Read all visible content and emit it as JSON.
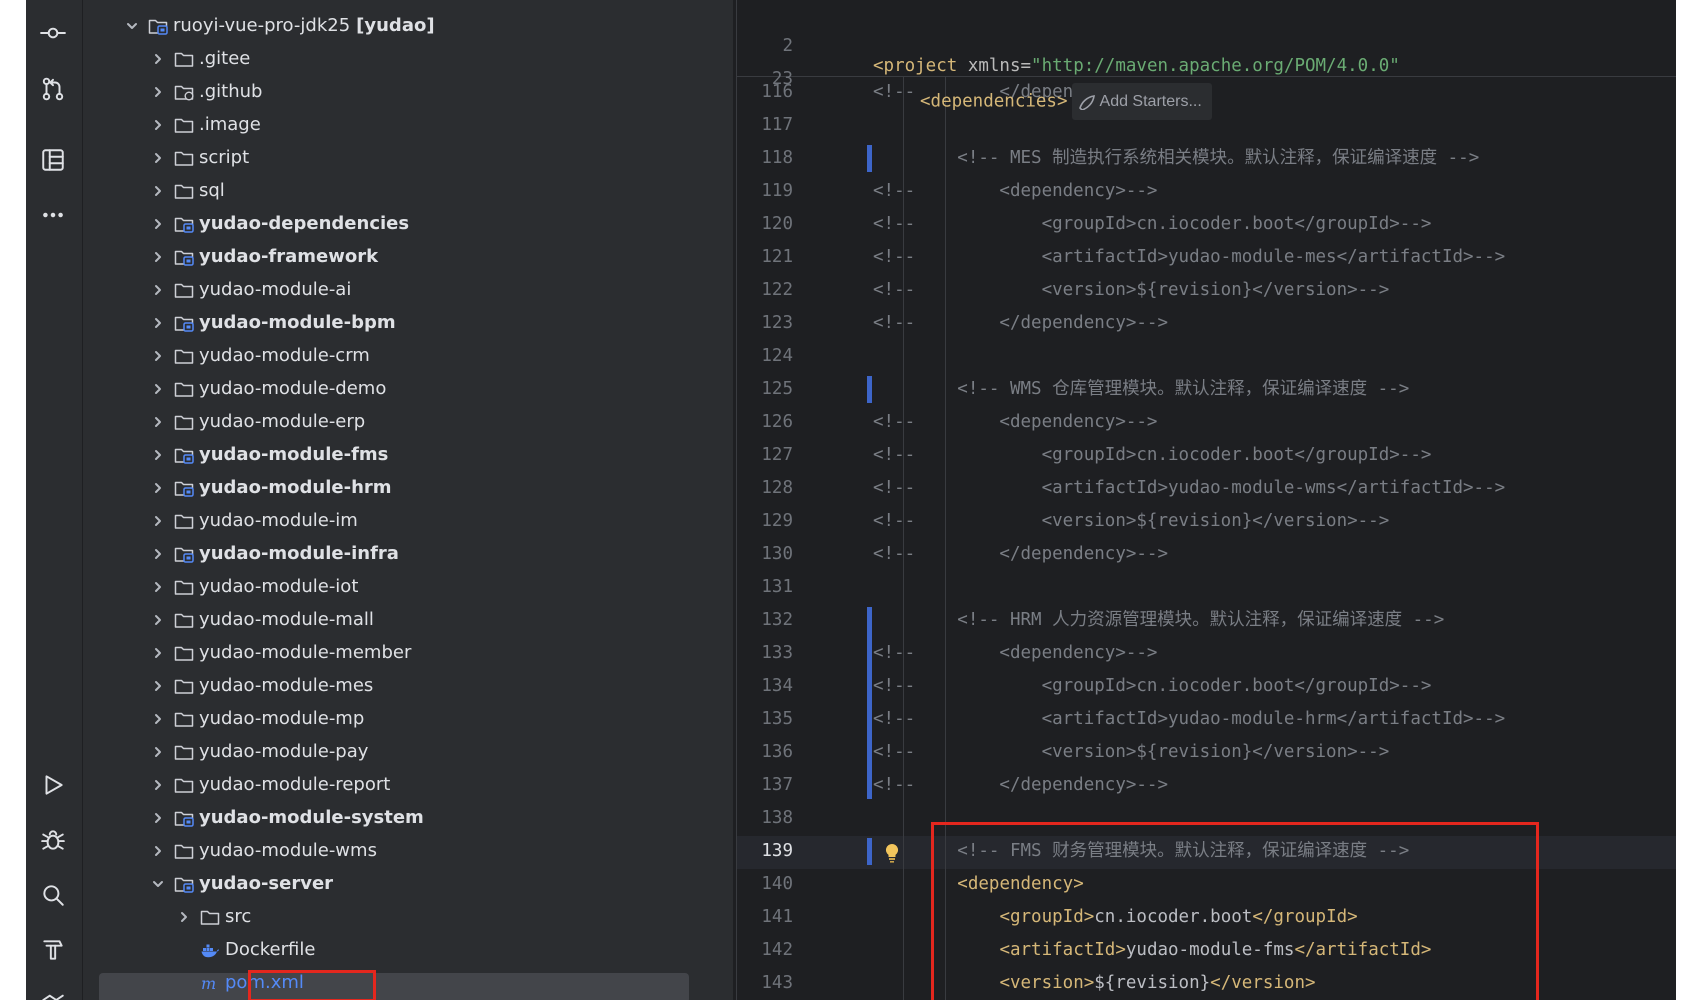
{
  "activity_bar": {
    "top_icons": [
      "commit-icon",
      "pull-requests-icon",
      "structure-icon",
      "more-icon"
    ],
    "bottom_icons": [
      "run-icon",
      "debug-icon",
      "search-icon",
      "build-icon",
      "git-icon"
    ]
  },
  "project_tree": {
    "root": {
      "name": "ruoyi-vue-pro-jdk25",
      "module": "[yudao]"
    },
    "items": [
      {
        "label": ".gitee",
        "type": "folder",
        "bold": false
      },
      {
        "label": ".github",
        "type": "folder-special",
        "bold": false
      },
      {
        "label": ".image",
        "type": "folder",
        "bold": false
      },
      {
        "label": "script",
        "type": "folder",
        "bold": false
      },
      {
        "label": "sql",
        "type": "folder",
        "bold": false
      },
      {
        "label": "yudao-dependencies",
        "type": "module",
        "bold": true
      },
      {
        "label": "yudao-framework",
        "type": "module",
        "bold": true
      },
      {
        "label": "yudao-module-ai",
        "type": "folder",
        "bold": false
      },
      {
        "label": "yudao-module-bpm",
        "type": "module",
        "bold": true
      },
      {
        "label": "yudao-module-crm",
        "type": "folder",
        "bold": false
      },
      {
        "label": "yudao-module-demo",
        "type": "folder",
        "bold": false
      },
      {
        "label": "yudao-module-erp",
        "type": "folder",
        "bold": false
      },
      {
        "label": "yudao-module-fms",
        "type": "module",
        "bold": true
      },
      {
        "label": "yudao-module-hrm",
        "type": "module",
        "bold": true
      },
      {
        "label": "yudao-module-im",
        "type": "folder",
        "bold": false
      },
      {
        "label": "yudao-module-infra",
        "type": "module",
        "bold": true
      },
      {
        "label": "yudao-module-iot",
        "type": "folder",
        "bold": false
      },
      {
        "label": "yudao-module-mall",
        "type": "folder",
        "bold": false
      },
      {
        "label": "yudao-module-member",
        "type": "folder",
        "bold": false
      },
      {
        "label": "yudao-module-mes",
        "type": "folder",
        "bold": false
      },
      {
        "label": "yudao-module-mp",
        "type": "folder",
        "bold": false
      },
      {
        "label": "yudao-module-pay",
        "type": "folder",
        "bold": false
      },
      {
        "label": "yudao-module-report",
        "type": "folder",
        "bold": false
      },
      {
        "label": "yudao-module-system",
        "type": "module",
        "bold": true
      },
      {
        "label": "yudao-module-wms",
        "type": "folder",
        "bold": false
      }
    ],
    "server": {
      "label": "yudao-server",
      "src": "src",
      "dockerfile": "Dockerfile",
      "pom": "pom.xml"
    }
  },
  "editor": {
    "sticky": [
      {
        "num": "2",
        "pre": "<project ",
        "attr": "xmlns=",
        "val": "\"http://maven.apache.org/POM/4.0.0\""
      },
      {
        "num": "23",
        "tag": "<dependencies>",
        "hint": "Add Starters..."
      }
    ],
    "lines": [
      {
        "num": "116",
        "kind": "c",
        "text": "<!--        </dependency>-->"
      },
      {
        "num": "117",
        "kind": "blank",
        "text": ""
      },
      {
        "num": "118",
        "kind": "c",
        "text": "        <!-- MES 制造执行系统相关模块。默认注释，保证编译速度 -->"
      },
      {
        "num": "119",
        "kind": "c",
        "text": "<!--        <dependency>-->"
      },
      {
        "num": "120",
        "kind": "c",
        "text": "<!--            <groupId>cn.iocoder.boot</groupId>-->"
      },
      {
        "num": "121",
        "kind": "c",
        "text": "<!--            <artifactId>yudao-module-mes</artifactId>-->"
      },
      {
        "num": "122",
        "kind": "c",
        "text": "<!--            <version>${revision}</version>-->"
      },
      {
        "num": "123",
        "kind": "c",
        "text": "<!--        </dependency>-->"
      },
      {
        "num": "124",
        "kind": "blank",
        "text": ""
      },
      {
        "num": "125",
        "kind": "c",
        "text": "        <!-- WMS 仓库管理模块。默认注释，保证编译速度 -->"
      },
      {
        "num": "126",
        "kind": "c",
        "text": "<!--        <dependency>-->"
      },
      {
        "num": "127",
        "kind": "c",
        "text": "<!--            <groupId>cn.iocoder.boot</groupId>-->"
      },
      {
        "num": "128",
        "kind": "c",
        "text": "<!--            <artifactId>yudao-module-wms</artifactId>-->"
      },
      {
        "num": "129",
        "kind": "c",
        "text": "<!--            <version>${revision}</version>-->"
      },
      {
        "num": "130",
        "kind": "c",
        "text": "<!--        </dependency>-->"
      },
      {
        "num": "131",
        "kind": "blank",
        "text": ""
      },
      {
        "num": "132",
        "kind": "c",
        "text": "        <!-- HRM 人力资源管理模块。默认注释，保证编译速度 -->"
      },
      {
        "num": "133",
        "kind": "c",
        "text": "<!--        <dependency>-->"
      },
      {
        "num": "134",
        "kind": "c",
        "text": "<!--            <groupId>cn.iocoder.boot</groupId>-->"
      },
      {
        "num": "135",
        "kind": "c",
        "text": "<!--            <artifactId>yudao-module-hrm</artifactId>-->"
      },
      {
        "num": "136",
        "kind": "c",
        "text": "<!--            <version>${revision}</version>-->"
      },
      {
        "num": "137",
        "kind": "c",
        "text": "<!--        </dependency>-->"
      },
      {
        "num": "138",
        "kind": "blank",
        "text": ""
      },
      {
        "num": "139",
        "kind": "c",
        "text": "        <!-- FMS 财务管理模块。默认注释，保证编译速度 -->"
      },
      {
        "num": "140",
        "kind": "x",
        "indent": "        ",
        "open": "<dependency>",
        "value": "",
        "close": ""
      },
      {
        "num": "141",
        "kind": "x",
        "indent": "            ",
        "open": "<groupId>",
        "value": "cn.iocoder.boot",
        "close": "</groupId>"
      },
      {
        "num": "142",
        "kind": "x",
        "indent": "            ",
        "open": "<artifactId>",
        "value": "yudao-module-fms",
        "close": "</artifactId>"
      },
      {
        "num": "143",
        "kind": "x",
        "indent": "            ",
        "open": "<version>",
        "value": "${revision}",
        "close": "</version>"
      }
    ],
    "active_line": "139"
  }
}
